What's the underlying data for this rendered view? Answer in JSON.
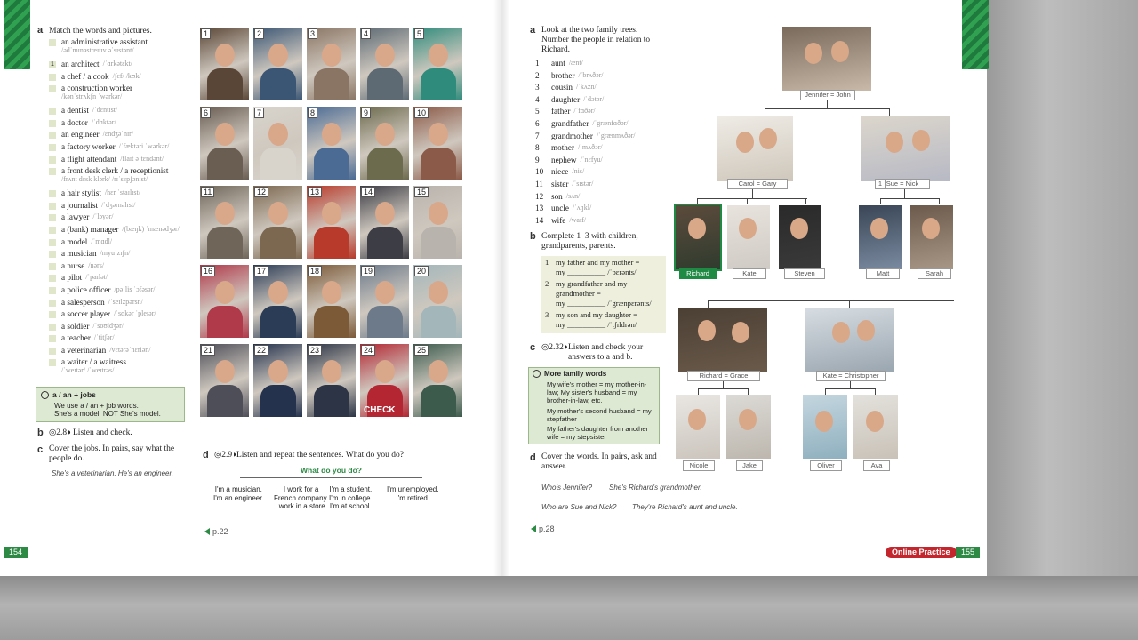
{
  "left_page": {
    "a_letter": "a",
    "a_instruction": "Match the words and pictures.",
    "words": [
      {
        "text": "an administrative assistant",
        "phon": "/ədˈmɪnəstreɪtɪv əˈsɪstənt/",
        "two_line": true
      },
      {
        "text": "an architect",
        "phon": "/ˈɑrkətɛkt/",
        "box": "1"
      },
      {
        "text": "a chef / a cook",
        "phon": "/ʃɛf/ /kʊk/"
      },
      {
        "text": "a construction worker",
        "phon": "/kənˈstrʌkʃn ˈwərkər/",
        "two_line": true
      },
      {
        "text": "a dentist",
        "phon": "/ˈdɛntɪst/"
      },
      {
        "text": "a doctor",
        "phon": "/ˈdɑktər/"
      },
      {
        "text": "an engineer",
        "phon": "/ɛndʒəˈnɪr/"
      },
      {
        "text": "a factory worker",
        "phon": "/ˈfæktəri ˈwərkər/"
      },
      {
        "text": "a flight attendant",
        "phon": "/flaɪt əˈtɛndənt/"
      },
      {
        "text": "a front desk clerk / a receptionist",
        "phon": "/frʌnt dɛsk klərk/ /rɪˈsɛpʃənɪst/",
        "two_line": true
      },
      {
        "text": "a hair stylist",
        "phon": "/hɛr ˈstaɪlɪst/"
      },
      {
        "text": "a journalist",
        "phon": "/ˈdʒərnəlɪst/"
      },
      {
        "text": "a lawyer",
        "phon": "/ˈlɔyər/"
      },
      {
        "text": "a (bank) manager",
        "phon": "/(bæŋk) ˈmænədʒər/"
      },
      {
        "text": "a model",
        "phon": "/ˈmɑdl/"
      },
      {
        "text": "a musician",
        "phon": "/myuˈzɪʃn/"
      },
      {
        "text": "a nurse",
        "phon": "/nərs/"
      },
      {
        "text": "a pilot",
        "phon": "/ˈpaɪlət/"
      },
      {
        "text": "a police officer",
        "phon": "/pəˈlis ˈɔfəsər/"
      },
      {
        "text": "a salesperson",
        "phon": "/ˈseɪlzpərsn/"
      },
      {
        "text": "a soccer player",
        "phon": "/ˈsɑkər ˈpleɪər/"
      },
      {
        "text": "a soldier",
        "phon": "/ˈsoʊldʒər/"
      },
      {
        "text": "a teacher",
        "phon": "/ˈtitʃər/"
      },
      {
        "text": "a veterinarian",
        "phon": "/vɛtərəˈnɛriən/"
      },
      {
        "text": "a waiter / a waitress",
        "phon": "/ˈweɪtər/ /ˈweɪtrəs/",
        "two_line": true
      }
    ],
    "tip_title": "a / an + jobs",
    "tip_line1": "We use a / an + job words.",
    "tip_line2": "She's a model. NOT She's model.",
    "b_letter": "b",
    "b_audio": "2.8",
    "b_text": "Listen and check.",
    "c_letter": "c",
    "c_text": "Cover the jobs. In pairs, say what the people do.",
    "c_example": "She's a veterinarian. He's an engineer.",
    "d_letter": "d",
    "d_audio": "2.9",
    "d_text": "Listen and repeat the sentences. What do you do?",
    "d_question": "What do you do?",
    "d_options": [
      "I'm a musician.\nI'm an engineer.",
      "I work for a\nFrench company.\nI work in a store.",
      "I'm a student.\nI'm in college.\nI'm at school.",
      "I'm unemployed.\nI'm retired."
    ],
    "ref": "p.22",
    "page_number": "154",
    "tiles": [
      "1",
      "2",
      "3",
      "4",
      "5",
      "6",
      "7",
      "8",
      "9",
      "10",
      "11",
      "12",
      "13",
      "14",
      "15",
      "16",
      "17",
      "18",
      "19",
      "20",
      "21",
      "22",
      "23",
      "24",
      "25"
    ],
    "tile_colors": [
      "#5a4636",
      "#3b5674",
      "#8a7564",
      "#5d6a73",
      "#2f8c7c",
      "#6a5d52",
      "#d8d4cc",
      "#4b6b94",
      "#6d6b4e",
      "#8c5a48",
      "#6f6659",
      "#7c6850",
      "#b83a2a",
      "#3d3d45",
      "#b9b3ad",
      "#b0394a",
      "#2b3c56",
      "#7c5a38",
      "#6c7a8a",
      "#a3b6ba",
      "#4e4e58",
      "#24324d",
      "#2c3445",
      "#b32632",
      "#3c5b4d"
    ],
    "tile_sign": "CHECK"
  },
  "right_page": {
    "a_letter": "a",
    "a_instruction": "Look at the two family trees. Number the people in relation to Richard.",
    "family_words": [
      {
        "num": "1",
        "word": "aunt",
        "phon": "/ænt/"
      },
      {
        "num": "2",
        "word": "brother",
        "phon": "/ˈbrʌðər/"
      },
      {
        "num": "3",
        "word": "cousin",
        "phon": "/ˈkʌzn/"
      },
      {
        "num": "4",
        "word": "daughter",
        "phon": "/ˈdɔtər/"
      },
      {
        "num": "5",
        "word": "father",
        "phon": "/ˈfɑðər/"
      },
      {
        "num": "6",
        "word": "grandfather",
        "phon": "/ˈgrænfɑðər/"
      },
      {
        "num": "7",
        "word": "grandmother",
        "phon": "/ˈgrænmʌðər/"
      },
      {
        "num": "8",
        "word": "mother",
        "phon": "/ˈmʌðər/"
      },
      {
        "num": "9",
        "word": "nephew",
        "phon": "/ˈnɛfyu/"
      },
      {
        "num": "10",
        "word": "niece",
        "phon": "/nis/"
      },
      {
        "num": "11",
        "word": "sister",
        "phon": "/ˈsɪstər/"
      },
      {
        "num": "12",
        "word": "son",
        "phon": "/sʌn/"
      },
      {
        "num": "13",
        "word": "uncle",
        "phon": "/ˈʌŋkl/"
      },
      {
        "num": "14",
        "word": "wife",
        "phon": "/waɪf/"
      }
    ],
    "b_letter": "b",
    "b_text": "Complete 1–3 with children, grandparents, parents.",
    "fill": [
      {
        "num": "1",
        "line1": "my father and my mother =",
        "line2": "my __________ /ˈpɛrənts/"
      },
      {
        "num": "2",
        "line1": "my grandfather and my",
        "line2": "grandmother =",
        "line3": "my __________ /ˈgrænpɛrənts/"
      },
      {
        "num": "3",
        "line1": "my son and my daughter =",
        "line2": "my __________ /ˈtʃɪldrən/"
      }
    ],
    "c_letter": "c",
    "c_audio": "2.32",
    "c_text": "Listen and check your answers to a and b.",
    "more_title": "More family words",
    "more_lines": [
      "My wife's mother = my mother-in-law; My sister's husband = my brother-in-law, etc.",
      "My mother's second husband = my stepfather",
      "My father's daughter from another wife = my stepsister"
    ],
    "d_letter": "d",
    "d_text": "Cover the words. In pairs, ask and answer.",
    "d_q1": "Who's Jennifer?",
    "d_a1": "She's Richard's grandmother.",
    "d_q2": "Who are Sue and Nick?",
    "d_a2": "They're Richard's aunt and uncle.",
    "ref": "p.28",
    "online": "Online Practice",
    "page_number": "155",
    "tree": {
      "grandparents": "Jennifer = John",
      "couple1": "Carol = Gary",
      "couple2_num": "1",
      "couple2": "Sue = Nick",
      "children": [
        "Richard",
        "Kate",
        "Steven",
        "Matt",
        "Sarah"
      ],
      "couple3": "Richard = Grace",
      "couple4": "Kate = Christopher",
      "grandchildren": [
        "Nicole",
        "Jake",
        "Oliver",
        "Ava"
      ]
    }
  }
}
